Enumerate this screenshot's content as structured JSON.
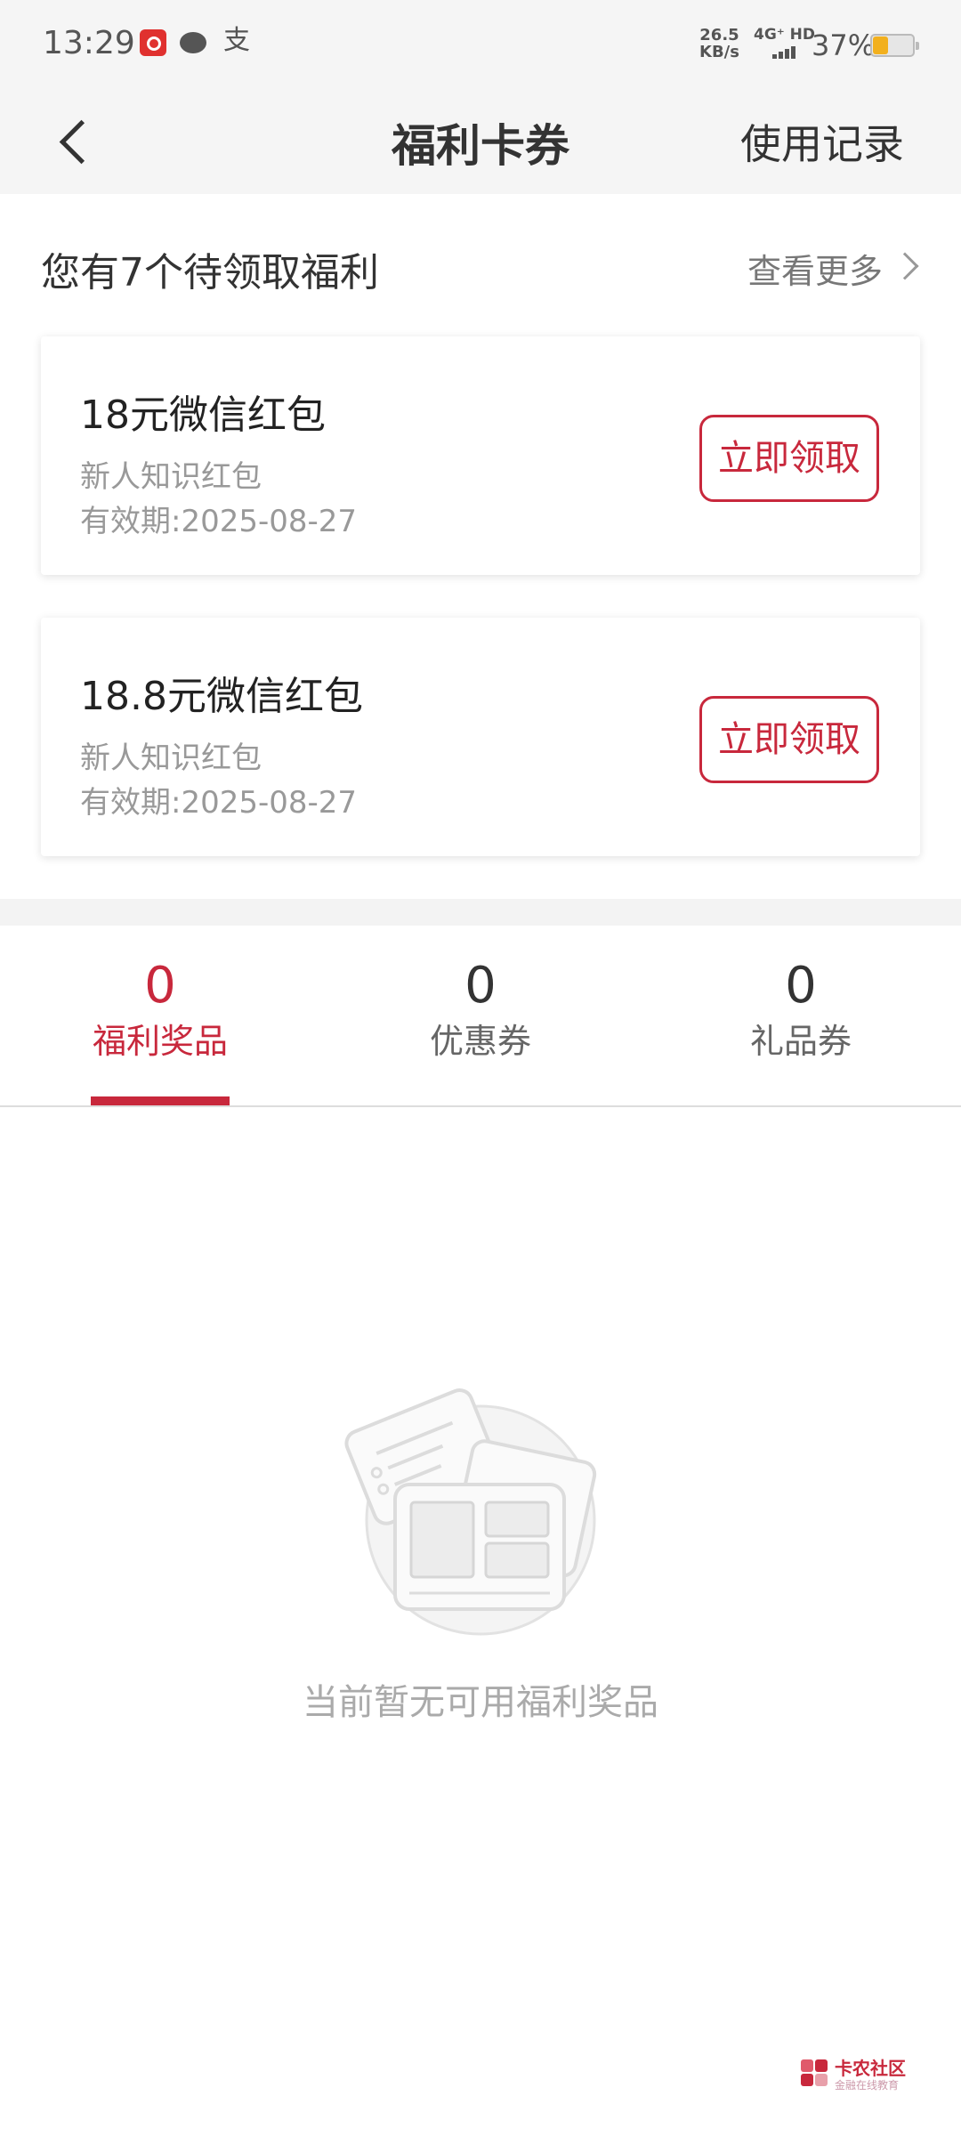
{
  "status_bar": {
    "time": "13:29",
    "speed_value": "26.5",
    "speed_unit": "KB/s",
    "network": "4G⁺ HD",
    "battery_percent": "37%",
    "battery_level": 0.37,
    "battery_color": "#f2b01e",
    "app_icons": [
      "netease-music-icon",
      "chat-icon",
      "alipay-icon"
    ]
  },
  "nav": {
    "title": "福利卡券",
    "action": "使用记录",
    "back_icon": "chevron-left-icon"
  },
  "welfare": {
    "title": "您有7个待领取福利",
    "see_more": "查看更多",
    "cards": [
      {
        "name": "18元微信红包",
        "desc": "新人知识红包",
        "expiry": "有效期:2025-08-27",
        "button": "立即领取"
      },
      {
        "name": "18.8元微信红包",
        "desc": "新人知识红包",
        "expiry": "有效期:2025-08-27",
        "button": "立即领取"
      }
    ]
  },
  "tabs": [
    {
      "count": "0",
      "label": "福利奖品",
      "active": true
    },
    {
      "count": "0",
      "label": "优惠券",
      "active": false
    },
    {
      "count": "0",
      "label": "礼品券",
      "active": false
    }
  ],
  "empty_state": {
    "text": "当前暂无可用福利奖品",
    "icon": "empty-coupons-illustration"
  },
  "watermark": {
    "title": "卡农社区",
    "subtitle": "金融在线教育"
  },
  "colors": {
    "accent": "#c8283c",
    "header_bg": "#f5f5f5",
    "muted_text": "#999999"
  }
}
